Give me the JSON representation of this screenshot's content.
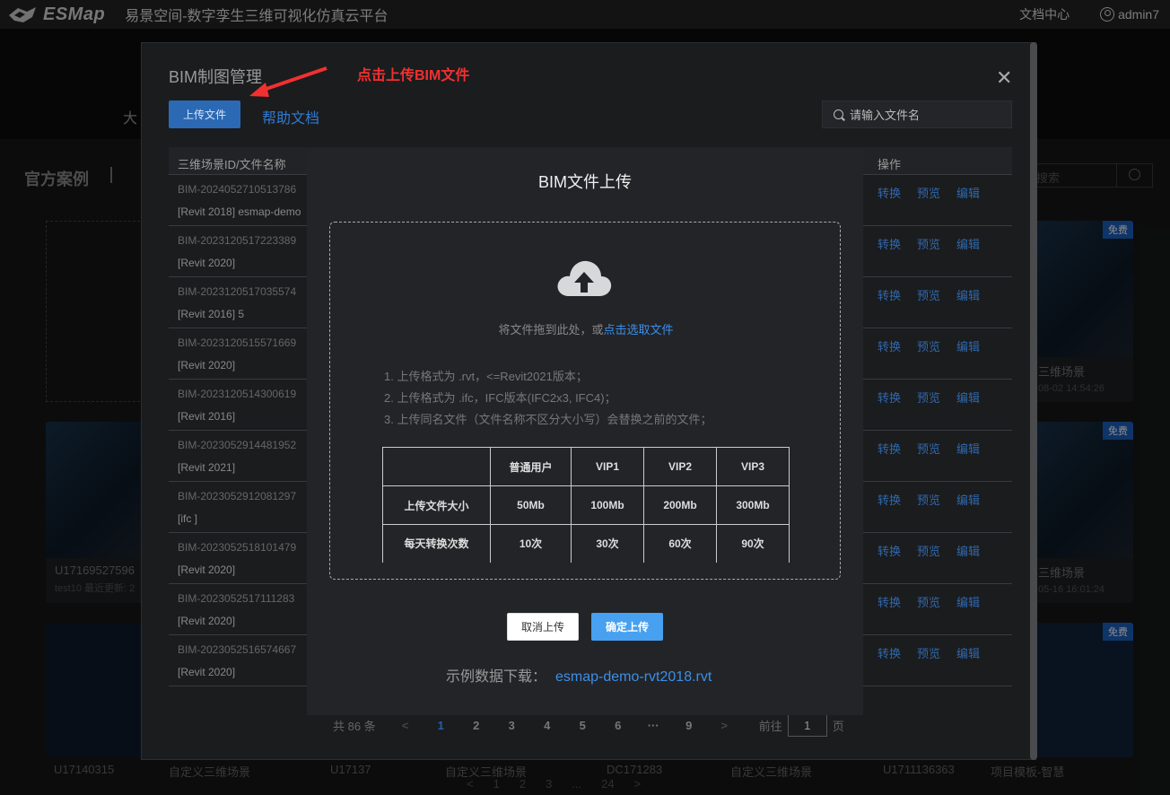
{
  "topbar": {
    "brand": "ESMap",
    "platform": "易景空间-数字孪生三维可视化仿真云平台",
    "docs": "文档中心",
    "username": "admin7"
  },
  "background": {
    "tab": "大",
    "category": "官方案例",
    "search_placeholder": "搜索",
    "free_badge": "免费",
    "cards": [
      {
        "title": "三维场景",
        "meta": "08-02 14:54:26"
      },
      {
        "title": "U17169527596",
        "meta": "test10 最近更新: 2"
      },
      {
        "title": "三维场景",
        "meta": "05-16 16:01:24"
      }
    ],
    "bottom_titles": [
      "U17140315",
      "自定义三维场景",
      "U17137",
      "自定义三维场景",
      "DC171283",
      "自定义三维场景",
      "U1711136363",
      "项目模板-智慧"
    ],
    "pager": [
      "<",
      "1",
      "2",
      "3",
      "...",
      "24",
      ">"
    ]
  },
  "mgmt": {
    "title": "BIM制图管理",
    "upload_button": "上传文件",
    "help_link": "帮助文档",
    "search_placeholder": "请输入文件名",
    "col_id_name": "三维场景ID/文件名称",
    "col_ops": "操作",
    "rows": [
      {
        "id": "BIM-2024052710513786",
        "name": "[Revit 2018] esmap-demo"
      },
      {
        "id": "BIM-2023120517223389",
        "name": "[Revit 2020]"
      },
      {
        "id": "BIM-2023120517035574",
        "name": "[Revit 2016] 5"
      },
      {
        "id": "BIM-2023120515571669",
        "name": "[Revit 2020]"
      },
      {
        "id": "BIM-2023120514300619",
        "name": "[Revit 2016]"
      },
      {
        "id": "BIM-2023052914481952",
        "name": "[Revit 2021]"
      },
      {
        "id": "BIM-2023052912081297",
        "name": "[ifc ]"
      },
      {
        "id": "BIM-2023052518101479",
        "name": "[Revit 2020]"
      },
      {
        "id": "BIM-2023052517111283",
        "name": "[Revit 2020]"
      },
      {
        "id": "BIM-2023052516574667",
        "name": "[Revit 2020]"
      }
    ],
    "ops": [
      "转换",
      "预览",
      "编辑"
    ],
    "total": "共 86 条",
    "pages": [
      "1",
      "2",
      "3",
      "4",
      "5",
      "6",
      "···",
      "9"
    ],
    "goto_label": "前往",
    "goto_value": "1",
    "goto_suffix": "页"
  },
  "annotation": "点击上传BIM文件",
  "upload": {
    "title": "BIM文件上传",
    "drop_text": "将文件拖到此处，或",
    "drop_pick": "点击选取文件",
    "rules": [
      "1. 上传格式为 .rvt，<=Revit2021版本；",
      "2. 上传格式为 .ifc，IFC版本(IFC2x3, IFC4)；",
      "3. 上传同名文件（文件名称不区分大小写）会替换之前的文件；"
    ],
    "quota_headers": [
      "",
      "普通用户",
      "VIP1",
      "VIP2",
      "VIP3"
    ],
    "quota_rows": [
      [
        "上传文件大小",
        "50Mb",
        "100Mb",
        "200Mb",
        "300Mb"
      ],
      [
        "每天转换次数",
        "10次",
        "30次",
        "60次",
        "90次"
      ]
    ],
    "cancel": "取消上传",
    "confirm": "确定上传",
    "sample_label": "示例数据下载：",
    "sample_file": "esmap-demo-rvt2018.rvt"
  },
  "colors": {
    "accent": "#2c69b4",
    "link": "#3d8ee8",
    "annotation": "#f23030",
    "confirm": "#47a0f0"
  }
}
